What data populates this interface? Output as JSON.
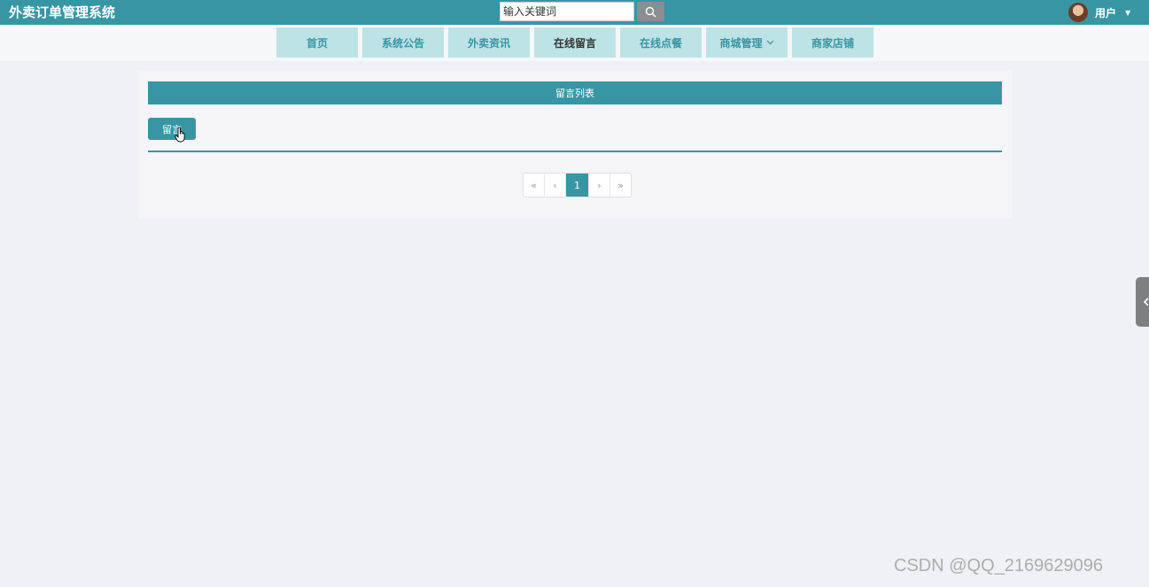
{
  "header": {
    "app_title": "外卖订单管理系统",
    "search": {
      "placeholder": "输入关键词",
      "value": ""
    },
    "user_label": "用户"
  },
  "nav": {
    "items": [
      {
        "label": "首页"
      },
      {
        "label": "系统公告"
      },
      {
        "label": "外卖资讯"
      },
      {
        "label": "在线留言",
        "active": true
      },
      {
        "label": "在线点餐"
      },
      {
        "label": "商城管理",
        "has_dropdown": true
      },
      {
        "label": "商家店铺"
      }
    ]
  },
  "panel": {
    "title": "留言列表",
    "message_button": "留言"
  },
  "pagination": {
    "first": "«",
    "prev": "‹",
    "current": "1",
    "next": "›",
    "last": "»"
  },
  "watermark": "CSDN @QQ_2169629096",
  "colors": {
    "primary": "#3896a4",
    "nav_bg": "#bde3e6",
    "page_bg": "#f0f1f6"
  }
}
